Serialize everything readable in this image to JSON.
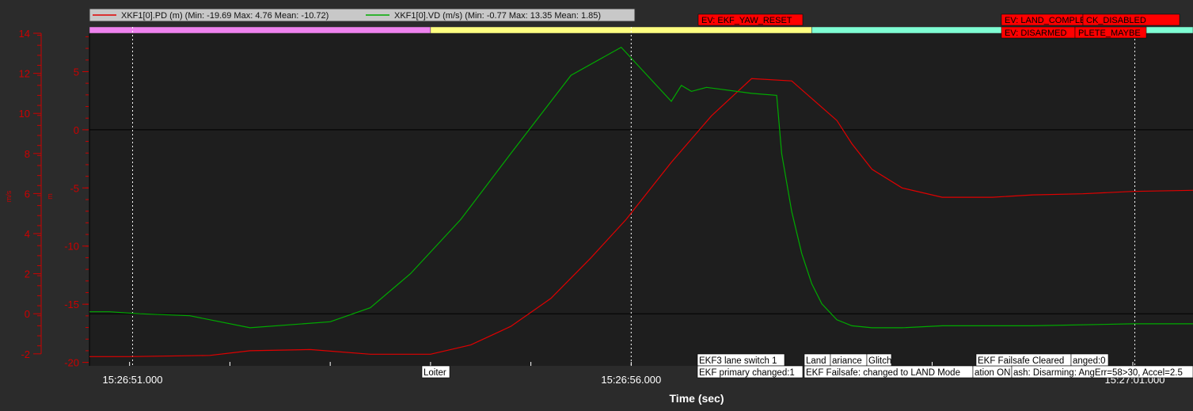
{
  "colors": {
    "background": "#2b2b2b",
    "plot_background": "#1e1e1e",
    "left_axis": "#cc0000",
    "series_pd": "#e00000",
    "series_vd": "#00aa00",
    "event_box": "#ff0000",
    "mode_bar_1": "#ee82ee",
    "mode_bar_2": "#ffff80",
    "mode_bar_3": "#7fffd4"
  },
  "chart_data": {
    "type": "line",
    "xlabel": "Time (sec)",
    "x_ticks": [
      "15:26:51.000",
      "15:26:56.000",
      "15:27:01.000"
    ],
    "x_range_sec": [
      50.6,
      61.6
    ],
    "y_left": {
      "unit_label": "m/s",
      "ylim": [
        -2.6,
        14
      ],
      "ticks": [
        -2,
        0,
        2,
        4,
        6,
        8,
        10,
        12,
        14
      ]
    },
    "y_right": {
      "unit_label": "m",
      "ylim": [
        -20.3,
        8.3
      ],
      "ticks": [
        -20,
        -15,
        -10,
        -5,
        0,
        5
      ]
    },
    "legend": [
      {
        "label": "XKF1[0].PD (m)  (Min: -19.69 Max: 4.76 Mean: -10.72)",
        "color_key": "series_pd"
      },
      {
        "label": "XKF1[0].VD (m/s)  (Min: -0.77 Max: 13.35 Mean: 1.85)",
        "color_key": "series_vd"
      }
    ],
    "series": [
      {
        "name": "XKF1[0].PD (m)",
        "axis": "right",
        "x": [
          50.6,
          51.0,
          51.8,
          52.2,
          52.8,
          53.4,
          54.0,
          54.4,
          54.8,
          55.2,
          55.6,
          55.95,
          56.4,
          56.8,
          57.2,
          57.6,
          58.05,
          58.2,
          58.4,
          58.7,
          59.1,
          59.6,
          60.0,
          60.5,
          61.0,
          61.6
        ],
        "y": [
          -19.5,
          -19.5,
          -19.4,
          -19.0,
          -18.9,
          -19.3,
          -19.3,
          -18.5,
          -16.9,
          -14.5,
          -11.0,
          -7.7,
          -2.8,
          1.2,
          4.4,
          4.2,
          0.8,
          -1.2,
          -3.4,
          -5.0,
          -5.8,
          -5.8,
          -5.6,
          -5.5,
          -5.3,
          -5.2
        ]
      },
      {
        "name": "XKF1[0].VD (m/s)",
        "axis": "left",
        "x": [
          50.6,
          50.8,
          51.1,
          51.6,
          52.2,
          53.0,
          53.4,
          53.8,
          54.3,
          54.8,
          55.4,
          55.9,
          56.4,
          56.5,
          56.6,
          56.75,
          56.9,
          57.2,
          57.45,
          57.5,
          57.6,
          57.7,
          57.8,
          57.9,
          58.05,
          58.2,
          58.4,
          58.7,
          59.1,
          60.0,
          61.0,
          61.6
        ],
        "y": [
          0.1,
          0.1,
          0.0,
          -0.1,
          -0.7,
          -0.4,
          0.3,
          2.0,
          4.7,
          8.0,
          11.9,
          13.3,
          10.6,
          11.4,
          11.1,
          11.3,
          11.2,
          11.0,
          10.9,
          8.0,
          5.1,
          3.0,
          1.5,
          0.5,
          -0.3,
          -0.6,
          -0.7,
          -0.7,
          -0.6,
          -0.6,
          -0.5,
          -0.5
        ]
      }
    ],
    "mode_bars": [
      {
        "x0": 50.6,
        "x1": 54.0,
        "color_key": "mode_bar_1"
      },
      {
        "x0": 54.0,
        "x1": 57.8,
        "color_key": "mode_bar_2"
      },
      {
        "x0": 57.8,
        "x1": 61.6,
        "color_key": "mode_bar_3"
      }
    ],
    "event_lines_x": [
      51.03,
      56.0,
      61.02
    ],
    "events": [
      {
        "text": "EV: EKF_YAW_RESET",
        "row": 0
      },
      {
        "text": "EV: LAND_COMPLETE",
        "row": 0
      },
      {
        "text": "CK_DISABLED",
        "row": 0
      },
      {
        "text": "EV: DISARMED",
        "row": 1
      },
      {
        "text": "PLETE_MAYBE",
        "row": 1
      }
    ],
    "messages": [
      {
        "text": "Loiter",
        "row": 1
      },
      {
        "text": "EKF3 lane switch 1",
        "row": 0
      },
      {
        "text": "EKF primary changed:1",
        "row": 1
      },
      {
        "text": "Land",
        "row": 0
      },
      {
        "text": "ariance",
        "row": 0
      },
      {
        "text": "Glitch",
        "row": 0
      },
      {
        "text": "EKF Failsafe: changed to LAND Mode",
        "row": 1
      },
      {
        "text": "ation ON",
        "row": 1
      },
      {
        "text": "EKF Failsafe Cleared",
        "row": 0
      },
      {
        "text": "anged:0",
        "row": 0
      },
      {
        "text": "ash: Disarming: AngErr=58>30, Accel=2.5",
        "row": 1
      }
    ]
  }
}
